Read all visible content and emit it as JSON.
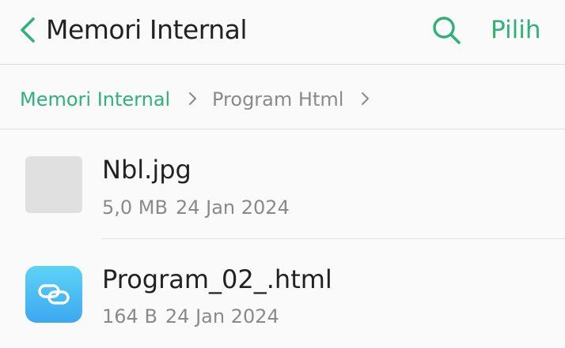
{
  "header": {
    "title": "Memori Internal",
    "select_label": "Pilih",
    "back_icon": "chevron-left-icon",
    "search_icon": "search-icon",
    "accent_color": "#2fb27a"
  },
  "breadcrumb": {
    "items": [
      {
        "label": "Memori Internal"
      },
      {
        "label": "Program Html"
      }
    ],
    "separator_icon": "chevron-right-icon"
  },
  "files": [
    {
      "name": "Nbl.jpg",
      "size": "5,0 MB",
      "date": "24 Jan 2024",
      "icon": "image-thumbnail-icon"
    },
    {
      "name": "Program_02_.html",
      "size": "164 B",
      "date": "24 Jan 2024",
      "icon": "link-file-icon"
    }
  ]
}
